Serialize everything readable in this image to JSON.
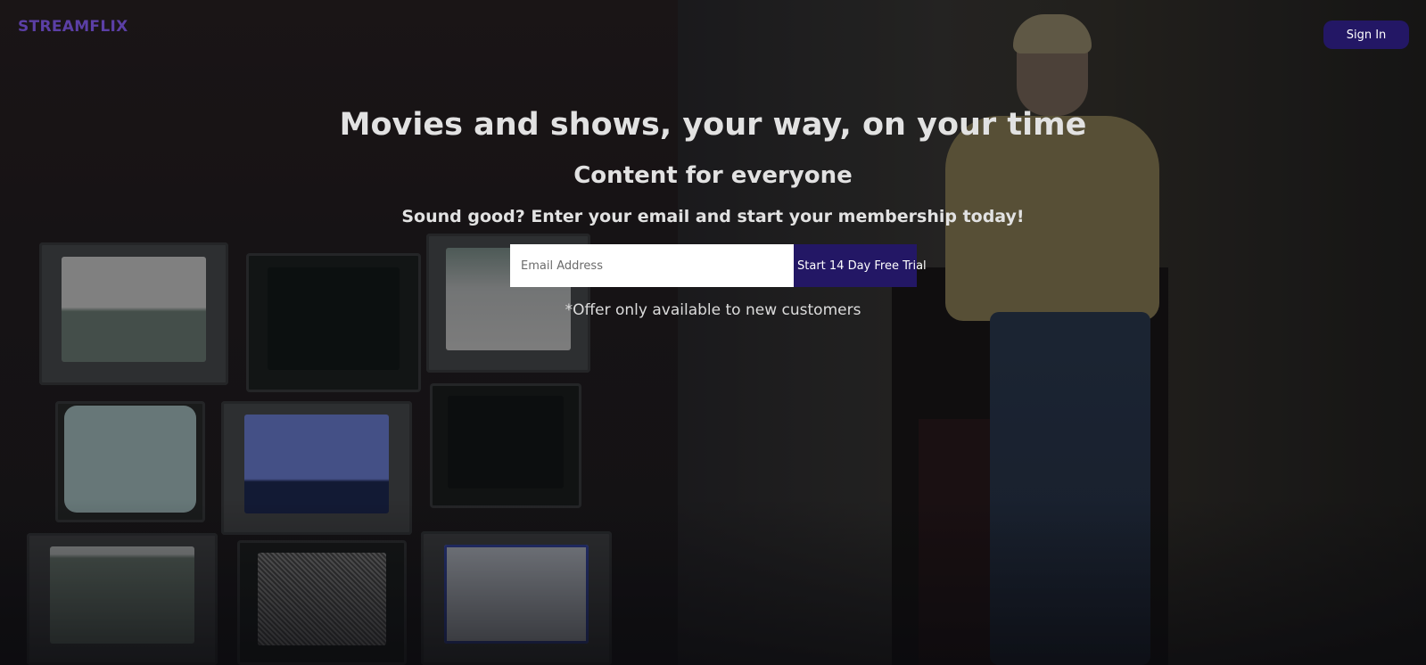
{
  "header": {
    "brand": "STREAMFLIX",
    "sign_in_label": "Sign In"
  },
  "hero": {
    "headline": "Movies and shows, your way, on your time",
    "subheadline": "Content for everyone",
    "cta_text": "Sound good? Enter your email and start your membership today!",
    "email_placeholder": "Email Address",
    "trial_button_label": "Start 14 Day Free Trial",
    "offer_note": "*Offer only available to new customers"
  },
  "colors": {
    "brand": "#5b3fa5",
    "button_bg": "#231765",
    "text": "#e2e2e2"
  }
}
